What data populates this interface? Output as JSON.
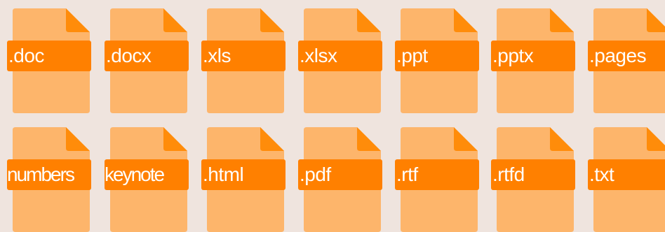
{
  "colors": {
    "background": "#EFE4DE",
    "page": "#FDB56B",
    "fold": "#FF8C0A",
    "label": "#FF8000",
    "label_text": "#FFFFFF"
  },
  "icon": "document-file-icon",
  "rows": [
    [
      ".doc",
      ".docx",
      ".xls",
      ".xlsx",
      ".ppt",
      ".pptx",
      ".pages"
    ],
    [
      "numbers",
      "keynote",
      ".html",
      ".pdf",
      ".rtf",
      ".rtfd",
      ".txt"
    ]
  ]
}
